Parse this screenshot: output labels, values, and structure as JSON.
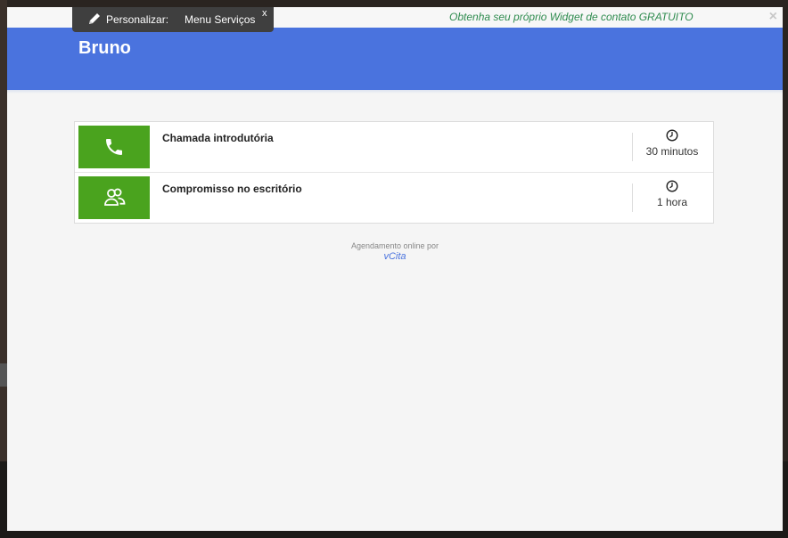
{
  "toolbar": {
    "customize_label": "Personalizar:",
    "menu_label": "Menu Serviços",
    "close_label": "x"
  },
  "promo": {
    "link_text": "Obtenha seu próprio Widget de contato GRATUITO"
  },
  "modal": {
    "close_label": "×"
  },
  "header": {
    "title": "Bruno"
  },
  "services": [
    {
      "name": "Chamada introdutória",
      "duration": "30 minutos",
      "icon": "phone-icon"
    },
    {
      "name": "Compromisso no escritório",
      "duration": "1 hora",
      "icon": "people-icon"
    }
  ],
  "footer": {
    "note": "Agendamento online por",
    "brand": "vCita"
  },
  "colors": {
    "header_blue": "#4a73de",
    "service_green": "#4aa31e",
    "promo_green": "#2e8b4e"
  }
}
